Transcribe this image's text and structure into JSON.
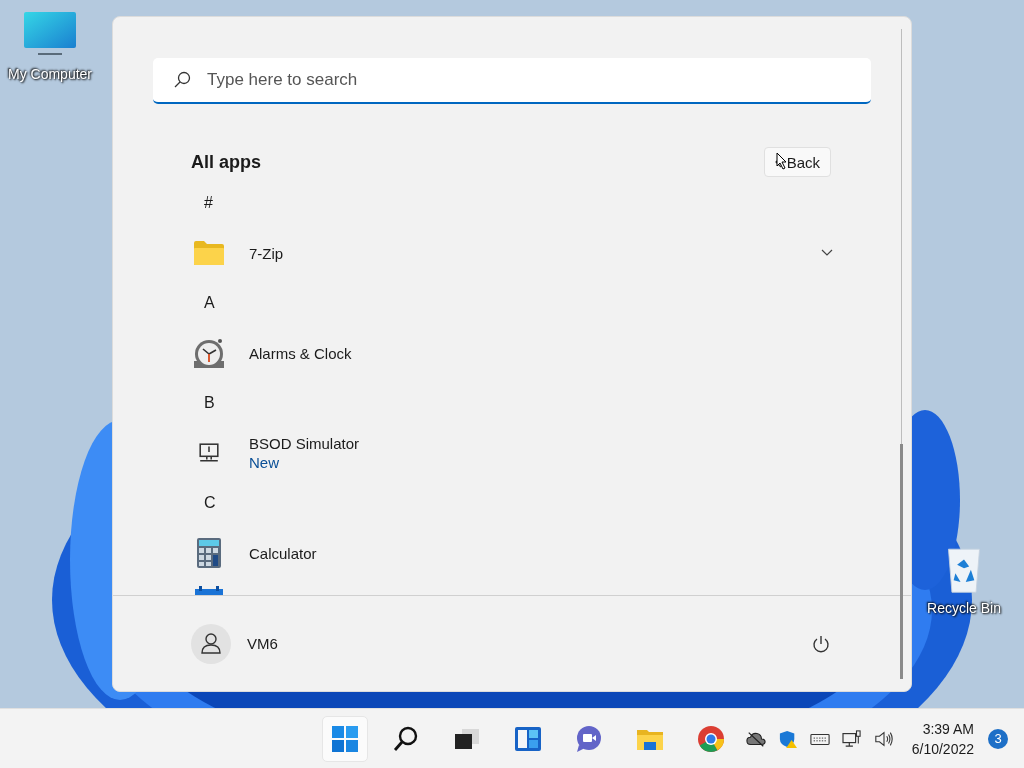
{
  "desktop_icons": [
    {
      "label": "My Computer"
    },
    {
      "label": "Recycle Bin"
    }
  ],
  "start_menu": {
    "search": {
      "placeholder": "Type here to search"
    },
    "heading": "All apps",
    "back_button": "Back",
    "items": [
      {
        "kind": "letter",
        "label": "#"
      },
      {
        "kind": "app",
        "name": "7-Zip",
        "expandable": true
      },
      {
        "kind": "letter",
        "label": "A"
      },
      {
        "kind": "app",
        "name": "Alarms & Clock",
        "expandable": false
      },
      {
        "kind": "letter",
        "label": "B"
      },
      {
        "kind": "app",
        "name": "BSOD Simulator",
        "badge": "New",
        "expandable": false
      },
      {
        "kind": "letter",
        "label": "C"
      },
      {
        "kind": "app",
        "name": "Calculator",
        "expandable": false
      }
    ],
    "user": {
      "name": "VM6"
    }
  },
  "taskbar": {
    "pinned": [
      {
        "selected": true
      },
      {
        "selected": false
      },
      {
        "selected": false
      },
      {
        "selected": false
      },
      {
        "selected": false
      },
      {
        "selected": false
      },
      {
        "selected": false
      }
    ],
    "clock": {
      "time": "3:39 AM",
      "date": "6/10/2022"
    },
    "notification_count": "3"
  }
}
